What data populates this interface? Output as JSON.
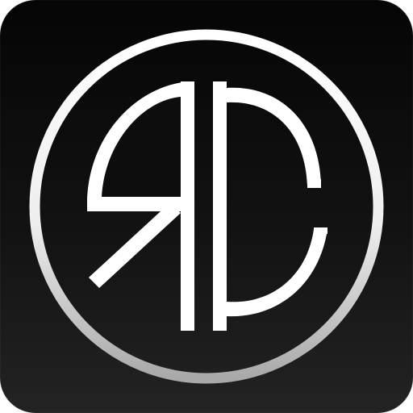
{
  "app_icon": {
    "icon": "rc-monogram-logo-icon",
    "monogram_letters": "RC",
    "colors": {
      "tile_top": "#050505",
      "tile_bottom": "#232323",
      "ring_light": "#ffffff",
      "ring_dark": "#a9a9a9",
      "glyph": "#ffffff"
    }
  }
}
